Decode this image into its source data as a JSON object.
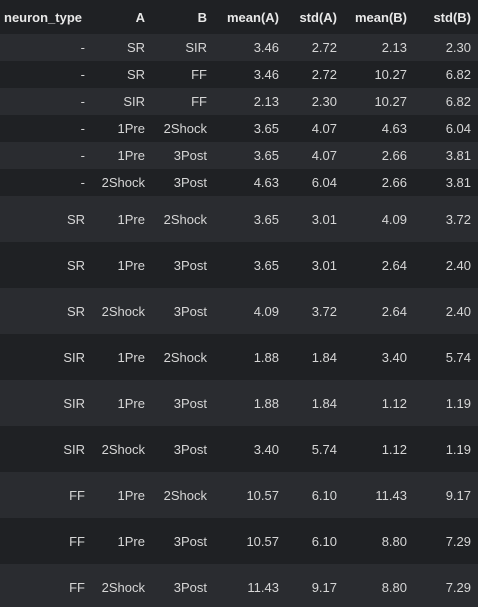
{
  "table": {
    "columns": [
      "neuron_type",
      "A",
      "B",
      "mean(A)",
      "std(A)",
      "mean(B)",
      "std(B)"
    ],
    "rows": [
      [
        "-",
        "SR",
        "SIR",
        "3.46",
        "2.72",
        "2.13",
        "2.30"
      ],
      [
        "-",
        "SR",
        "FF",
        "3.46",
        "2.72",
        "10.27",
        "6.82"
      ],
      [
        "-",
        "SIR",
        "FF",
        "2.13",
        "2.30",
        "10.27",
        "6.82"
      ],
      [
        "-",
        "1Pre",
        "2Shock",
        "3.65",
        "4.07",
        "4.63",
        "6.04"
      ],
      [
        "-",
        "1Pre",
        "3Post",
        "3.65",
        "4.07",
        "2.66",
        "3.81"
      ],
      [
        "-",
        "2Shock",
        "3Post",
        "4.63",
        "6.04",
        "2.66",
        "3.81"
      ],
      [
        "SR",
        "1Pre",
        "2Shock",
        "3.65",
        "3.01",
        "4.09",
        "3.72"
      ],
      [
        "SR",
        "1Pre",
        "3Post",
        "3.65",
        "3.01",
        "2.64",
        "2.40"
      ],
      [
        "SR",
        "2Shock",
        "3Post",
        "4.09",
        "3.72",
        "2.64",
        "2.40"
      ],
      [
        "SIR",
        "1Pre",
        "2Shock",
        "1.88",
        "1.84",
        "3.40",
        "5.74"
      ],
      [
        "SIR",
        "1Pre",
        "3Post",
        "1.88",
        "1.84",
        "1.12",
        "1.19"
      ],
      [
        "SIR",
        "2Shock",
        "3Post",
        "3.40",
        "5.74",
        "1.12",
        "1.19"
      ],
      [
        "FF",
        "1Pre",
        "2Shock",
        "10.57",
        "6.10",
        "11.43",
        "9.17"
      ],
      [
        "FF",
        "1Pre",
        "3Post",
        "10.57",
        "6.10",
        "8.80",
        "7.29"
      ],
      [
        "FF",
        "2Shock",
        "3Post",
        "11.43",
        "9.17",
        "8.80",
        "7.29"
      ]
    ]
  },
  "colors": {
    "background": "#1f2124",
    "row_stripe": "#2a2c30",
    "text": "#d6d6d6",
    "header_text": "#e8e8e8"
  }
}
